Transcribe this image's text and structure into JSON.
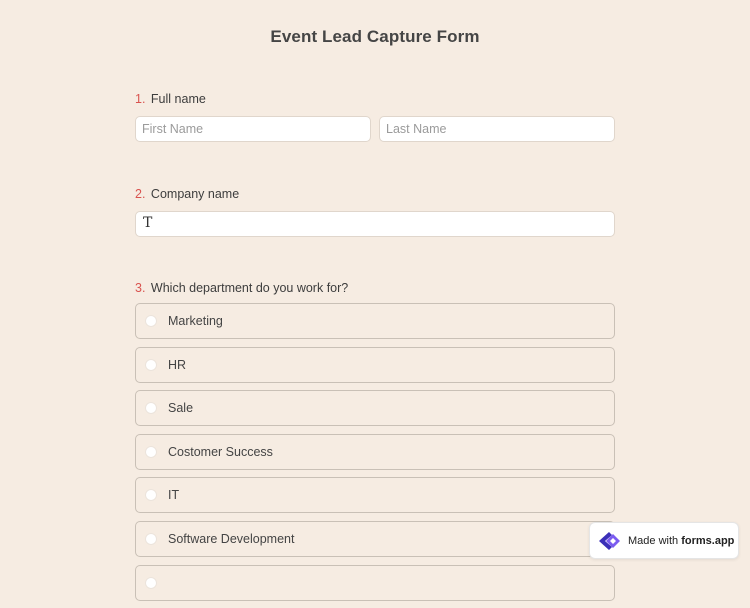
{
  "form": {
    "title": "Event Lead Capture Form"
  },
  "questions": {
    "full_name": {
      "number": "1.",
      "label": "Full name",
      "first_placeholder": "First Name",
      "last_placeholder": "Last Name"
    },
    "company": {
      "number": "2.",
      "label": "Company name",
      "value": ""
    },
    "department": {
      "number": "3.",
      "label": "Which department do you work for?",
      "options": [
        {
          "label": "Marketing"
        },
        {
          "label": "HR"
        },
        {
          "label": "Sale"
        },
        {
          "label": "Costomer Success"
        },
        {
          "label": "IT"
        },
        {
          "label": "Software Development"
        }
      ]
    }
  },
  "badge": {
    "prefix": "Made with",
    "brand": "forms.app",
    "icon": "forms-app-logo-icon",
    "brand_color": "#6b46e5"
  },
  "theme": {
    "background": "#f6ece2",
    "accent_number": "#d9534f"
  }
}
